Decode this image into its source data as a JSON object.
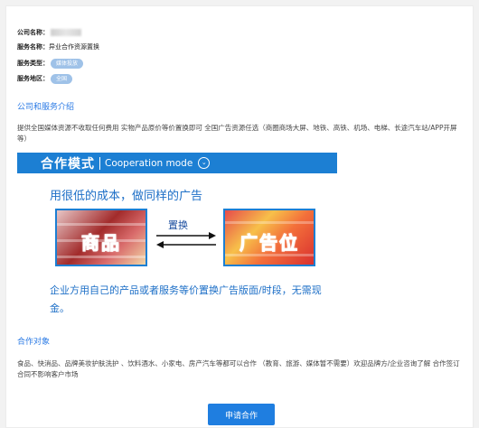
{
  "info": {
    "company_label": "公司名称：",
    "service_name_label": "服务名称：",
    "service_name_value": "异业合作资源置换",
    "service_type_label": "服务类型：",
    "service_type_value": "媒体投放",
    "service_area_label": "服务地区：",
    "service_area_value": "全国"
  },
  "intro": {
    "title": "公司和服务介绍",
    "text": "提供全国媒体资源不收取任何费用 实物产品原价等价置换即可 全国广告资源任选（商圈商场大屏、地铁、高铁、机场、电梯、长途汽车站/APP开屏等）"
  },
  "promo": {
    "header_cn": "合作模式",
    "header_en": "Cooperation mode",
    "header_icon": "chevron-down-circle-icon",
    "headline": "用很低的成本，做同样的广告",
    "product_label": "商品",
    "swap_label": "置换",
    "ad_label": "广告位",
    "caption": "企业方用自己的产品或者服务等价置换广告版面/时段，无需现金。"
  },
  "partners": {
    "title": "合作对象",
    "text": "食品、快消品、品牌美妆护肤洗护 、饮料酒水、小家电、房产汽车等都可以合作 （教育、旅游、媒体暂不需要）欢迎品牌方/企业咨询了解 合作签订合同不影响客户市场"
  },
  "actions": {
    "apply_label": "申请合作"
  },
  "colors": {
    "accent": "#1f7ee0",
    "pill": "#9fc2e8",
    "section_title": "#2c7be5"
  }
}
